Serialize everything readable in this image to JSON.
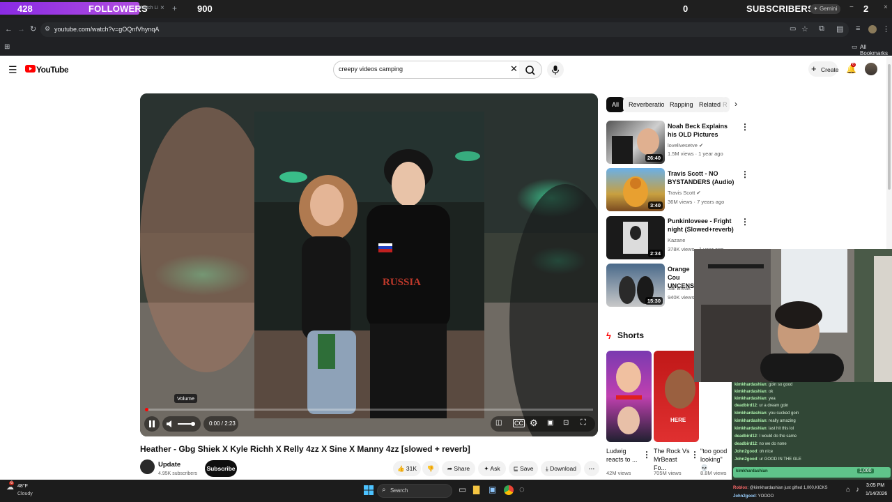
{
  "stream_overlay": {
    "followers_count": "428",
    "followers_label": "FOLLOWERS",
    "followers_goal": "900",
    "subscribers_count": "0",
    "subscribers_label": "SUBSCRIBERS",
    "right_value": "2",
    "tab_partial": "Watch Li",
    "gemini_label": "Gemini"
  },
  "browser": {
    "url": "youtube.com/watch?v=gOQnfVhynqA",
    "all_bookmarks": "All Bookmarks"
  },
  "header": {
    "logo_text": "YouTube",
    "search_value": "creepy videos camping",
    "create_label": "Create",
    "notification_count": "6"
  },
  "player": {
    "time": "0:00 / 2:23",
    "tooltip": "Volume",
    "progress": 0.0
  },
  "video": {
    "title": "Heather - Gbg Shiek X Kyle Richh X Relly 4zz X Sine X Manny 4zz [slowed + reverb]",
    "channel": "Update",
    "subscribers": "4.95K subscribers",
    "subscribe_label": "Subscribe",
    "likes": "31K",
    "share_label": "Share",
    "ask_label": "Ask",
    "save_label": "Save",
    "download_label": "Download"
  },
  "chips": [
    "All",
    "Reverberation",
    "Rapping",
    "Related",
    "R"
  ],
  "recommendations": [
    {
      "title": "Noah Beck Explains his OLD Pictures",
      "channel": "lovelivesetve",
      "meta": "1.5M views · 1 year ago",
      "duration": "26:40"
    },
    {
      "title": "Travis Scott - NO BYSTANDERS (Audio)",
      "channel": "Travis Scott",
      "meta": "36M views · 7 years ago",
      "duration": "3:40"
    },
    {
      "title": "Punkinloveee - Fright night (Slowed+reverb)",
      "channel": "Kazane",
      "meta": "378K views · 1 year ago",
      "duration": "2:34"
    },
    {
      "title": "Orange Cou UNCENSOR",
      "channel": "Jail Break",
      "meta": "940K views ·",
      "duration": "15:30"
    }
  ],
  "shorts": {
    "heading": "Shorts",
    "items": [
      {
        "title": "Ludwig reacts to ...",
        "views": "42M views"
      },
      {
        "title": "The Rock Vs MrBeast Fo...",
        "views": "705M views"
      },
      {
        "title": "\"too good looking\" 💀",
        "views": "8.8M views"
      }
    ]
  },
  "chat": {
    "lines": [
      {
        "user": "kimkhardashian",
        "text": "goin so good"
      },
      {
        "user": "kimkhardashian",
        "text": "ok"
      },
      {
        "user": "kimkhardashian",
        "text": "yea"
      },
      {
        "user": "deadbird12",
        "text": "ur a dream goin"
      },
      {
        "user": "kimkhardashian",
        "text": "you sucked goin"
      },
      {
        "user": "kimkhardashian",
        "text": "really amazing"
      },
      {
        "user": "kimkhardashian",
        "text": "last hit this lol"
      },
      {
        "user": "deadbird12",
        "text": "I would do the same"
      },
      {
        "user": "deadbird12",
        "text": "no we do none"
      },
      {
        "user": "John2good",
        "text": "oh nice"
      },
      {
        "user": "John2good",
        "text": "ur GOOD IN THE GLE"
      }
    ],
    "gift_banner": "kimkhardashian",
    "gift_amount": "1,000",
    "gift_line_user": "Roblox",
    "gift_line_text": "@kimkhardashian just gifted 1,000,KICKS",
    "last_line_user": "John2good",
    "last_line_text": "YOOOO"
  },
  "taskbar": {
    "weather_temp": "48°F",
    "weather_desc": "Cloudy",
    "weather_badge": "6",
    "search_placeholder": "Search",
    "time": "3:05 PM",
    "date": "1/14/2026"
  }
}
